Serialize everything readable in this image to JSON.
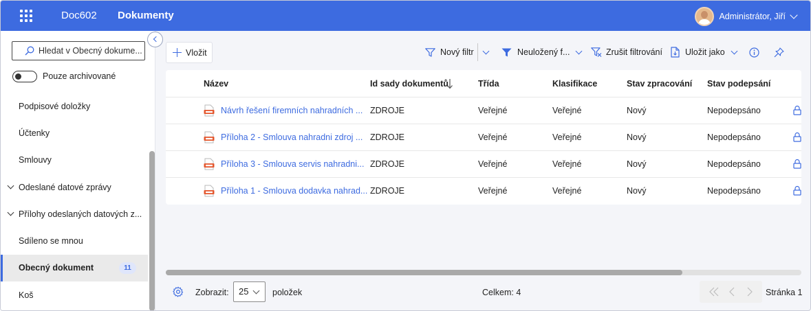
{
  "header": {
    "app_name": "Doc602",
    "section": "Dokumenty",
    "user_name": "Administrátor, Jiří",
    "accent": "#3d6be0"
  },
  "sidebar": {
    "search_placeholder": "Hledat v Obecný dokume...",
    "archive_toggle_label": "Pouze archivované",
    "archive_toggle_on": false,
    "items": [
      {
        "label": "Podpisové doložky",
        "expandable": false,
        "active": false
      },
      {
        "label": "Účtenky",
        "expandable": false,
        "active": false
      },
      {
        "label": "Smlouvy",
        "expandable": false,
        "active": false
      },
      {
        "label": "Odeslané datové zprávy",
        "expandable": true,
        "active": false
      },
      {
        "label": "Přílohy odeslaných datových z...",
        "expandable": true,
        "active": false
      },
      {
        "label": "Sdíleno se mnou",
        "expandable": false,
        "active": false
      },
      {
        "label": "Obecný dokument",
        "expandable": false,
        "active": true,
        "badge": "11"
      },
      {
        "label": "Koš",
        "expandable": false,
        "active": false
      }
    ]
  },
  "toolbar": {
    "insert_label": "Vložit",
    "new_filter_label": "Nový filtr",
    "unsaved_filter_label": "Neuložený f...",
    "clear_filter_label": "Zrušit filtrování",
    "save_as_label": "Uložit jako"
  },
  "table": {
    "columns": [
      "Název",
      "Id sady dokumentů",
      "Třída",
      "Klasifikace",
      "Stav zpracování",
      "Stav podepsání"
    ],
    "sorted_column": "Id sady dokumentů",
    "sort_direction": "descending",
    "rows": [
      {
        "name": "Návrh řešení firemních nahradních ...",
        "set_id": "ZDROJE",
        "class": "Veřejné",
        "classification": "Veřejné",
        "processing": "Nový",
        "signing": "Nepodepsáno"
      },
      {
        "name": "Příloha 2 - Smlouva nahradni zdroj ...",
        "set_id": "ZDROJE",
        "class": "Veřejné",
        "classification": "Veřejné",
        "processing": "Nový",
        "signing": "Nepodepsáno"
      },
      {
        "name": "Příloha 3 - Smlouva servis nahradni...",
        "set_id": "ZDROJE",
        "class": "Veřejné",
        "classification": "Veřejné",
        "processing": "Nový",
        "signing": "Nepodepsáno"
      },
      {
        "name": "Příloha 1 - Smlouva dodavka nahrad...",
        "set_id": "ZDROJE",
        "class": "Veřejné",
        "classification": "Veřejné",
        "processing": "Nový",
        "signing": "Nepodepsáno"
      }
    ]
  },
  "footer": {
    "show_label": "Zobrazit:",
    "page_size": "25",
    "items_label": "položek",
    "total_label": "Celkem: 4",
    "page_label": "Stránka 1"
  }
}
